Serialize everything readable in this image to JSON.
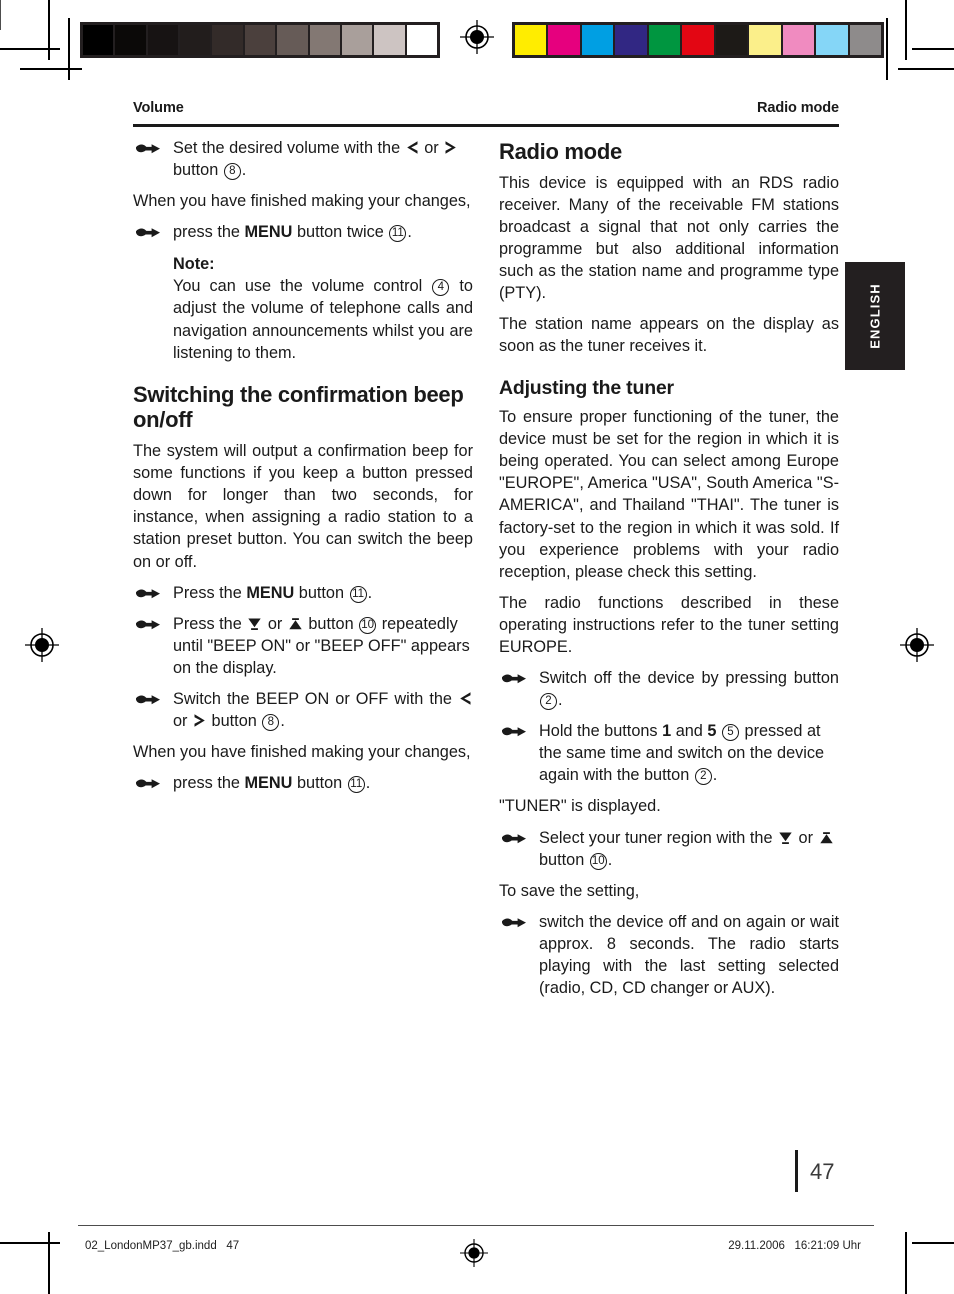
{
  "calibration": {
    "grayscale_swatches": [
      "#000000",
      "#0b0908",
      "#171313",
      "#221d1c",
      "#332b29",
      "#4b403d",
      "#665b57",
      "#837873",
      "#a99f9b",
      "#cdc4c2",
      "#ffffff"
    ],
    "color_swatches": [
      "#ffed00",
      "#e6007e",
      "#009fe3",
      "#312783",
      "#009640",
      "#e30613",
      "#1d1a17",
      "#fbef8a",
      "#f08bc0",
      "#85d6f7",
      "#8e8b8b"
    ]
  },
  "running_head": {
    "left": "Volume",
    "right": "Radio mode"
  },
  "language_tab": {
    "label": "ENGLISH"
  },
  "folio": {
    "page_number": "47"
  },
  "footer": {
    "file": "02_LondonMP37_gb.indd   47",
    "timestamp": "29.11.2006   16:21:09 Uhr"
  },
  "left_column": {
    "bullet_set_volume": {
      "text_a": "Set the desired volume with the ",
      "text_b": " or ",
      "text_c": " button ",
      "ref": "8",
      "text_d": "."
    },
    "para_finished_1": "When you have finished making your changes,",
    "bullet_press_menu_twice": {
      "text_a": "press the ",
      "bold": "MENU",
      "text_b": " button twice ",
      "ref": "11",
      "text_c": "."
    },
    "note": {
      "title": "Note:",
      "text_a": "You can use the volume control ",
      "ref": "4",
      "text_b": " to adjust the volume of telephone calls and navigation announcements whilst you are listening to them."
    },
    "heading_beep": "Switching the confirmation beep on/off",
    "para_beep_intro": "The system will output a confirmation beep for some functions if you keep a button pressed down for longer than two seconds, for instance, when assigning a radio station to a station preset button. You can switch the beep on or off.",
    "bullet_press_menu": {
      "text_a": "Press the ",
      "bold": "MENU",
      "text_b": " button ",
      "ref": "11",
      "text_c": "."
    },
    "bullet_press_updown": {
      "text_a": "Press the ",
      "text_b": " or ",
      "text_c": " button ",
      "ref": "10",
      "text_d": " repeatedly until \"BEEP ON\" or \"BEEP OFF\" appears on the display."
    },
    "bullet_switch_beep": {
      "text_a": "Switch the BEEP ON or OFF with the ",
      "text_b": " or ",
      "text_c": " button ",
      "ref": "8",
      "text_d": "."
    },
    "para_finished_2": "When you have finished making your changes,",
    "bullet_press_menu_final": {
      "text_a": "press the ",
      "bold": "MENU",
      "text_b": " button ",
      "ref": "11",
      "text_c": "."
    }
  },
  "right_column": {
    "heading_radio_mode": "Radio mode",
    "para_rds": "This device is equipped with an RDS radio receiver. Many of the receivable FM stations broadcast a signal that not only carries the programme but also additional information such as the station name and programme type (PTY).",
    "para_station_name": "The station name appears on the display as soon as the tuner receives it.",
    "heading_adjusting_tuner": "Adjusting the tuner",
    "para_region": "To ensure proper functioning of the tuner, the device must be set for the region in which it is being operated. You can select among Europe \"EUROPE\", America \"USA\", South America \"S-AMERICA\", and Thailand \"THAI\". The tuner is factory-set to the region in which it was sold. If you experience problems with your radio reception, please check this setting.",
    "para_europe": "The radio functions described in these operating instructions refer to the tuner setting EUROPE.",
    "bullet_switch_off": {
      "text_a": "Switch off the device by pressing button ",
      "ref": "2",
      "text_b": "."
    },
    "bullet_hold_buttons": {
      "text_a": "Hold the buttons ",
      "bold_a": "1",
      "text_b": " and ",
      "bold_b": "5",
      "ref_a": "5",
      "text_c": " pressed at the same time and switch on the device again with the button ",
      "ref_b": "2",
      "text_d": "."
    },
    "para_tuner_displayed": "\"TUNER\" is displayed.",
    "bullet_select_region": {
      "text_a": "Select your tuner region with the ",
      "text_b": " or ",
      "text_c": " button ",
      "ref": "10",
      "text_d": "."
    },
    "para_to_save": "To save the setting,",
    "bullet_switch_off_on": "switch the device off and on again or wait approx. 8 seconds. The radio starts playing with the last setting selected (radio, CD, CD changer or AUX)."
  }
}
